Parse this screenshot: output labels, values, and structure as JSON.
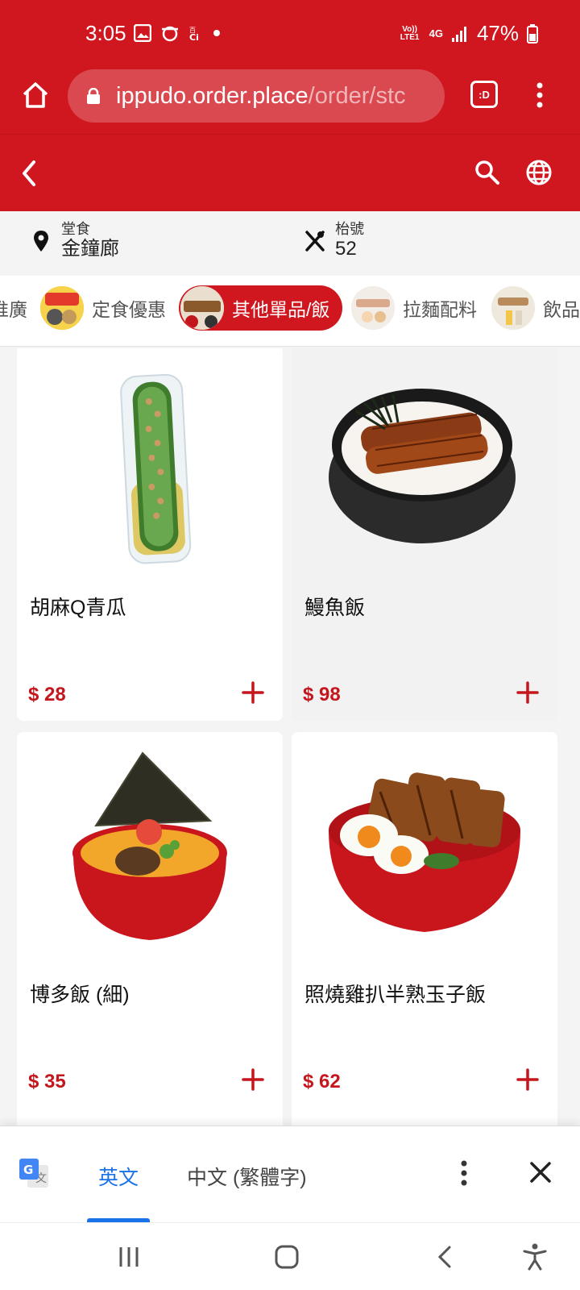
{
  "status_bar": {
    "time": "3:05",
    "network_volte": "Vo)) LTE1",
    "network_type": "4G",
    "battery": "47%"
  },
  "browser": {
    "url_host": "ippudo.order.place",
    "url_path": "/order/stc",
    "tab_label": ":D"
  },
  "info": {
    "mode_label": "堂食",
    "store": "金鐘廊",
    "table_label": "枱號",
    "table_number": "52"
  },
  "categories": [
    {
      "label": "推廣",
      "active": false
    },
    {
      "label": "定食優惠",
      "active": false
    },
    {
      "label": "其他單品/飯",
      "active": true
    },
    {
      "label": "拉麵配料",
      "active": false
    },
    {
      "label": "飲品",
      "active": false
    }
  ],
  "products": [
    {
      "name": "胡麻Q青瓜",
      "price": "$ 28"
    },
    {
      "name": "鰻魚飯",
      "price": "$ 98"
    },
    {
      "name": "博多飯 (細)",
      "price": "$ 35"
    },
    {
      "name": "照燒雞扒半熟玉子飯",
      "price": "$ 62"
    }
  ],
  "translate_bar": {
    "lang_selected": "英文",
    "lang_other": "中文 (繁體字)"
  },
  "colors": {
    "brand_red": "#d0161f",
    "price_red": "#c4161c",
    "translate_blue": "#1a73e8"
  },
  "icons": [
    "home-icon",
    "lock-icon",
    "tabs-icon",
    "more-vert-icon",
    "back-icon",
    "search-icon",
    "globe-icon",
    "location-pin-icon",
    "utensils-icon",
    "plus-icon",
    "google-translate-icon",
    "close-icon",
    "recents-icon",
    "home-nav-icon",
    "back-nav-icon",
    "accessibility-icon"
  ]
}
